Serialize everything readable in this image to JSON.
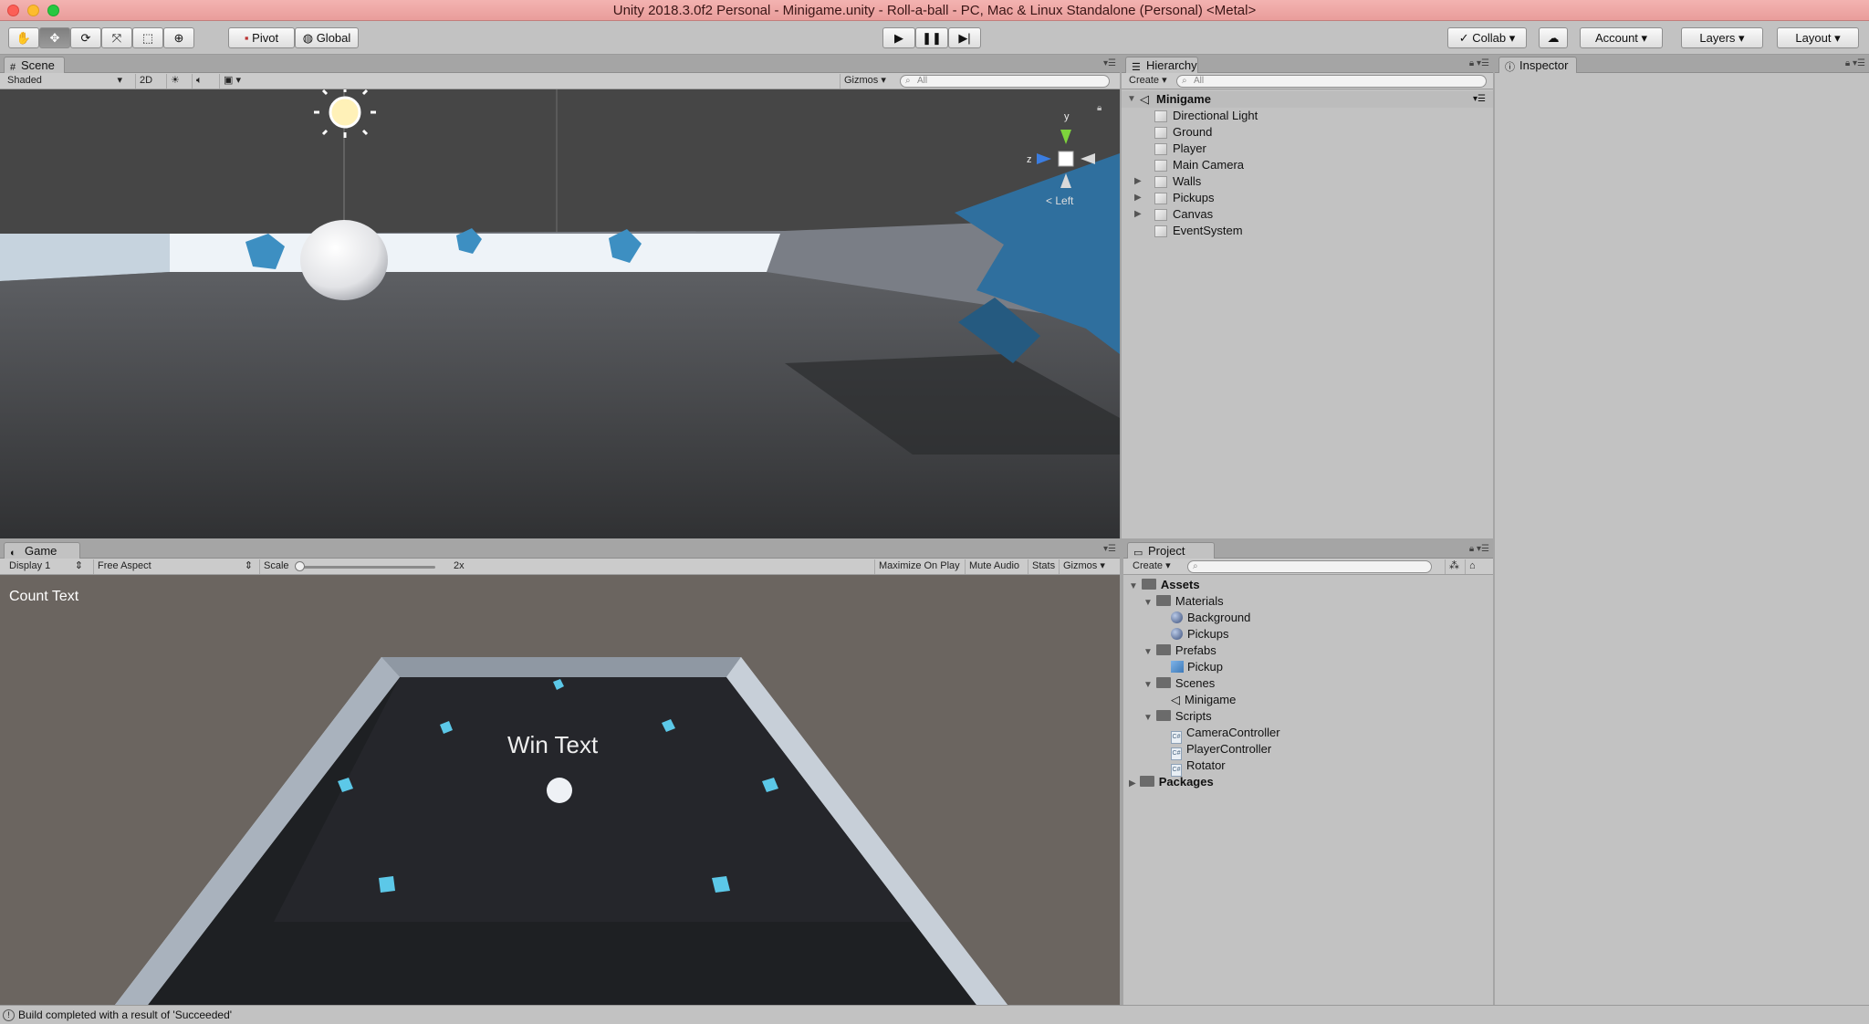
{
  "window": {
    "title": "Unity 2018.3.0f2 Personal - Minigame.unity - Roll-a-ball - PC, Mac & Linux Standalone (Personal) <Metal>"
  },
  "toolbar": {
    "pivot": "Pivot",
    "global": "Global",
    "collab": "Collab",
    "account": "Account",
    "layers": "Layers",
    "layout": "Layout"
  },
  "scene": {
    "tab": "Scene",
    "shading": "Shaded",
    "mode_2d": "2D",
    "gizmos": "Gizmos",
    "search_placeholder": "All",
    "gizmo_y": "y",
    "gizmo_z": "z",
    "view_label": "< Left"
  },
  "game": {
    "tab": "Game",
    "display": "Display 1",
    "aspect": "Free Aspect",
    "scale_label": "Scale",
    "scale_value": "2x",
    "maximize": "Maximize On Play",
    "mute": "Mute Audio",
    "stats": "Stats",
    "gizmos": "Gizmos",
    "count_text": "Count Text",
    "win_text": "Win Text"
  },
  "hierarchy": {
    "tab": "Hierarchy",
    "create": "Create",
    "search_placeholder": "All",
    "scene_name": "Minigame",
    "items": [
      {
        "label": "Directional Light",
        "expandable": false
      },
      {
        "label": "Ground",
        "expandable": false
      },
      {
        "label": "Player",
        "expandable": false
      },
      {
        "label": "Main Camera",
        "expandable": false
      },
      {
        "label": "Walls",
        "expandable": true
      },
      {
        "label": "Pickups",
        "expandable": true
      },
      {
        "label": "Canvas",
        "expandable": true
      },
      {
        "label": "EventSystem",
        "expandable": false
      }
    ]
  },
  "inspector": {
    "tab": "Inspector"
  },
  "project": {
    "tab": "Project",
    "create": "Create",
    "assets": "Assets",
    "materials": "Materials",
    "mat_background": "Background",
    "mat_pickups": "Pickups",
    "prefabs": "Prefabs",
    "prefab_pickup": "Pickup",
    "scenes": "Scenes",
    "scene_minigame": "Minigame",
    "scripts": "Scripts",
    "script_camera": "CameraController",
    "script_player": "PlayerController",
    "script_rotator": "Rotator",
    "packages": "Packages"
  },
  "status": {
    "message": "Build completed with a result of 'Succeeded'"
  },
  "colors": {
    "titlebar": "#eba3a1",
    "panel": "#c2c2c2",
    "scene_sky": "#464646",
    "game_bg": "#6b6560",
    "pickup": "#5cc8e8"
  }
}
